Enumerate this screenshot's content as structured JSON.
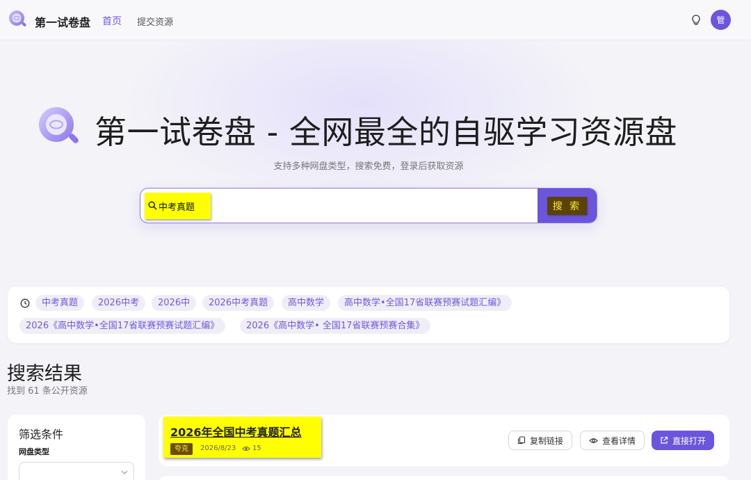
{
  "header": {
    "brand": "第一试卷盘",
    "nav": {
      "home": "首页",
      "submit": "提交资源"
    },
    "avatar_initial": "管",
    "accent": "#6b55dc"
  },
  "hero": {
    "title": "第一试卷盘 - 全网最全的自驱学习资源盘",
    "subtitle": "支持多种网盘类型，搜索免费，登录后获取资源"
  },
  "search": {
    "value": "中考真题",
    "button_label": "搜 索"
  },
  "history": {
    "icon": "clock-icon",
    "chips": [
      "中考真题",
      "2026中考",
      "2026中",
      "2026中考真题",
      "高中数学",
      "高中数学•全国17省联赛预赛试题汇编》",
      "2026《高中数学•全国17省联赛预赛试题汇编》",
      "2026《高中数学• 全国17省联赛预赛合集》"
    ]
  },
  "results": {
    "title": "搜索结果",
    "count_text": "找到 61 条公开资源"
  },
  "filter": {
    "title": "筛选条件",
    "disk_type_label": "网盘类型",
    "disk_type_value": ""
  },
  "result_items": [
    {
      "title": "2026年全国中考真题汇总",
      "tag": "夸克",
      "date": "2026/8/23",
      "views": "15",
      "copy_label": "复制链接",
      "detail_label": "查看详情",
      "open_label": "直接打开"
    }
  ]
}
